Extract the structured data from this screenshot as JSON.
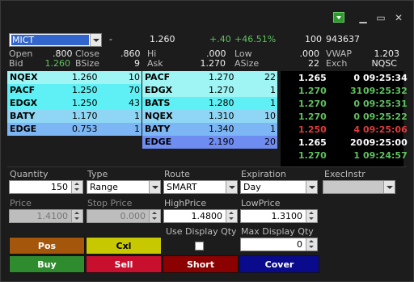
{
  "window": {
    "controls": {
      "menu": "▾",
      "minimize": "▁",
      "maximize": "▭",
      "close": "✕"
    }
  },
  "quote": {
    "symbol": "MICT",
    "change_sign": "-",
    "last": "1.260",
    "change": "+.40",
    "change_pct": "+46.51%",
    "last_size": "100",
    "volume": "943637",
    "row2": {
      "open_label": "Open",
      "open": ".800",
      "close_label": "Close",
      "close": ".860",
      "hi_label": "Hi",
      "hi": ".000",
      "low_label": "Low",
      "low": ".000",
      "vwap_label": "VWAP",
      "vwap": "1.203"
    },
    "row3": {
      "bid_label": "Bid",
      "bid": "1.260",
      "bsize_label": "BSize",
      "bsize": "9",
      "ask_label": "Ask",
      "ask": "1.270",
      "asize_label": "ASize",
      "asize": "22",
      "exch_label": "Exch",
      "exch": "NQSC"
    }
  },
  "book": {
    "bids": [
      {
        "mm": "NQEX",
        "price": "1.260",
        "size": "10",
        "tone": "light"
      },
      {
        "mm": "PACF",
        "price": "1.250",
        "size": "70",
        "tone": "cyan"
      },
      {
        "mm": "EDGX",
        "price": "1.250",
        "size": "43",
        "tone": "cyan"
      },
      {
        "mm": "BATY",
        "price": "1.170",
        "size": "1",
        "tone": "sky"
      },
      {
        "mm": "EDGE",
        "price": "0.753",
        "size": "1",
        "tone": "blue"
      }
    ],
    "asks": [
      {
        "mm": "PACF",
        "price": "1.270",
        "size": "22",
        "tone": "light"
      },
      {
        "mm": "EDGX",
        "price": "1.270",
        "size": "1",
        "tone": "light"
      },
      {
        "mm": "BATS",
        "price": "1.280",
        "size": "1",
        "tone": "cyan"
      },
      {
        "mm": "NQEX",
        "price": "1.310",
        "size": "10",
        "tone": "sky"
      },
      {
        "mm": "BATY",
        "price": "1.340",
        "size": "1",
        "tone": "blue"
      },
      {
        "mm": "EDGE",
        "price": "2.190",
        "size": "20",
        "tone": "dblue"
      }
    ]
  },
  "tape": [
    {
      "price": "1.265",
      "size": "0",
      "time": "09:25:34",
      "color": "#ffffff"
    },
    {
      "price": "1.270",
      "size": "31",
      "time": "09:25:32",
      "color": "#5ec25e"
    },
    {
      "price": "1.270",
      "size": "0",
      "time": "09:25:31",
      "color": "#5ec25e"
    },
    {
      "price": "1.270",
      "size": "0",
      "time": "09:25:22",
      "color": "#5ec25e"
    },
    {
      "price": "1.250",
      "size": "4",
      "time": "09:25:06",
      "color": "#e03a3a"
    },
    {
      "price": "1.265",
      "size": "20",
      "time": "09:25:00",
      "color": "#ffffff"
    },
    {
      "price": "1.270",
      "size": "1",
      "time": "09:24:57",
      "color": "#5ec25e"
    }
  ],
  "order": {
    "quantity_label": "Quantity",
    "quantity": "150",
    "type_label": "Type",
    "type": "Range",
    "route_label": "Route",
    "route": "SMART",
    "expiration_label": "Expiration",
    "expiration": "Day",
    "execinstr_label": "ExecInstr",
    "execinstr": "",
    "price_label": "Price",
    "price": "1.4100",
    "stop_label": "Stop Price",
    "stop": "0.000",
    "high_label": "HighPrice",
    "high": "1.4800",
    "low_label": "LowPrice",
    "low": "1.3100",
    "use_display_label": "Use Display Qty",
    "max_display_label": "Max Display Qty",
    "max_display": "0"
  },
  "buttons": {
    "pos": "Pos",
    "cxl": "Cxl",
    "buy": "Buy",
    "sell": "Sell",
    "short": "Short",
    "cover": "Cover"
  },
  "colors": {
    "pos": "#a4560a",
    "cxl": "#c8c800",
    "buy": "#2e8b2e",
    "sell": "#c8102e",
    "short": "#8b0000",
    "cover": "#0a0a8c"
  }
}
